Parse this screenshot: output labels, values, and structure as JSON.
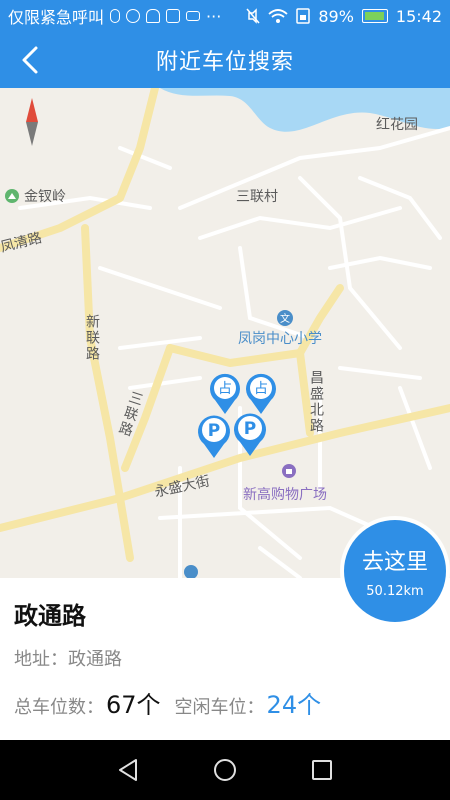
{
  "status_bar": {
    "left_text": "仅限紧急呼叫",
    "battery_percent": "89%",
    "time": "15:42",
    "battery_level": 0.89
  },
  "header": {
    "title": "附近车位搜索",
    "back_icon": "chevron-left-icon"
  },
  "map": {
    "labels": {
      "hongh_garden": "红花园",
      "jinchaling": "金钗岭",
      "sanlian_village": "三联村",
      "fengqing_road": "凤清路",
      "xinlian_road": "新联路",
      "fenggang_school": "凤岗中心小学",
      "changsheng_north": "昌盛北路",
      "sanlian_road": "三联路",
      "yongsheng_street": "永盛大街",
      "xingao_mall": "新高购物广场"
    },
    "markers": [
      {
        "type": "occupied",
        "label": "占"
      },
      {
        "type": "occupied",
        "label": "占"
      },
      {
        "type": "parking",
        "label": "P"
      },
      {
        "type": "parking",
        "label": "P"
      }
    ]
  },
  "go_button": {
    "label": "去这里",
    "distance": "50.12km"
  },
  "lot": {
    "name": "政通路",
    "address_label": "地址：",
    "address": "政通路",
    "total_label": "总车位数：",
    "total": "67个",
    "free_label": "空闲车位：",
    "free": "24个"
  },
  "colors": {
    "primary": "#2f8fe6",
    "map_bg": "#f2efe9",
    "road_major": "#f6e6a6",
    "water": "#a8d8f5"
  }
}
